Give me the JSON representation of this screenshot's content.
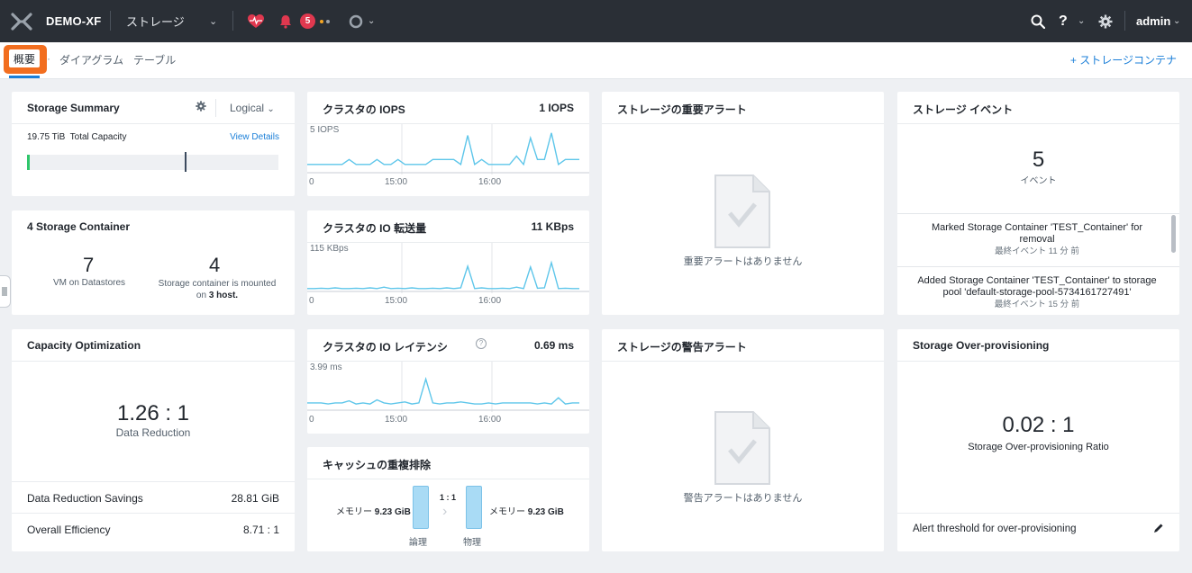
{
  "topbar": {
    "app_title": "DEMO-XF",
    "nav_label": "ストレージ",
    "alert_count": "5",
    "user": "admin",
    "colors": {
      "bg": "#2a2f36",
      "alert": "#e0384f",
      "dot_orange": "#f5a623",
      "dot_gray": "#9aa2ab"
    }
  },
  "subnav": {
    "tabs": [
      {
        "label": "概要",
        "active": true
      },
      {
        "label": "ダイアグラム"
      },
      {
        "label": "テーブル"
      }
    ],
    "separator": "·",
    "add_button": "+ ストレージコンテナ",
    "highlight_color": "#f26e1f"
  },
  "storage_summary": {
    "title": "Storage Summary",
    "mode": "Logical",
    "capacity_value": "19.75 TiB",
    "capacity_label": "Total Capacity",
    "details_link": "View Details",
    "usage_fraction": 0.01
  },
  "storage_container": {
    "title": "4 Storage Container",
    "vm_count": "7",
    "vm_label": "VM on Datastores",
    "container_count": "4",
    "container_label": "Storage container is mounted",
    "host_on": "on",
    "host_count": "3",
    "host_label": "host."
  },
  "capacity_opt": {
    "title": "Capacity Optimization",
    "ratio": "1.26 : 1",
    "ratio_label": "Data Reduction",
    "rows": [
      {
        "label": "Data Reduction Savings",
        "value": "28.81 GiB"
      },
      {
        "label": "Overall Efficiency",
        "value": "8.71 : 1"
      }
    ]
  },
  "iops_chart": {
    "title": "クラスタの IOPS",
    "current": "1 IOPS",
    "max_label": "5 IOPS",
    "ticks": [
      "0",
      "15:00",
      "16:00"
    ],
    "chart_data": {
      "type": "line",
      "y_max": 5,
      "values": [
        1,
        1,
        1,
        1,
        1,
        1,
        1.6,
        1,
        1,
        1,
        1.6,
        1,
        1,
        1.6,
        1,
        1,
        1,
        1,
        1.6,
        1.6,
        1.6,
        1.6,
        1,
        4.5,
        1,
        1.6,
        1,
        1,
        1,
        1,
        2,
        1,
        4.2,
        1.6,
        1.6,
        4.8,
        1,
        1.6,
        1.6,
        1.6
      ]
    }
  },
  "io_chart": {
    "title": "クラスタの IO 転送量",
    "current": "11 KBps",
    "max_label": "115 KBps",
    "ticks": [
      "0",
      "15:00",
      "16:00"
    ],
    "chart_data": {
      "type": "line",
      "y_max": 115,
      "values": [
        8,
        8,
        9,
        8,
        10,
        8,
        8,
        9,
        8,
        10,
        8,
        12,
        8,
        9,
        8,
        10,
        8,
        8,
        9,
        8,
        10,
        8,
        10,
        70,
        8,
        10,
        8,
        8,
        9,
        8,
        12,
        8,
        68,
        9,
        10,
        80,
        8,
        9,
        8,
        8
      ]
    }
  },
  "latency_chart": {
    "title": "クラスタの IO レイテンシ",
    "current": "0.69 ms",
    "max_label": "3.99 ms",
    "ticks": [
      "0",
      "15:00",
      "16:00"
    ],
    "chart_data": {
      "type": "line",
      "y_max": 3.99,
      "values": [
        0.7,
        0.7,
        0.7,
        0.6,
        0.7,
        0.7,
        0.9,
        0.6,
        0.7,
        0.6,
        1.0,
        0.7,
        0.6,
        0.7,
        0.8,
        0.6,
        0.7,
        3.0,
        0.7,
        0.6,
        0.7,
        0.7,
        0.8,
        0.7,
        0.6,
        0.6,
        0.7,
        0.6,
        0.7,
        0.7,
        0.7,
        0.7,
        0.7,
        0.6,
        0.7,
        0.6,
        1.2,
        0.6,
        0.7,
        0.7
      ]
    }
  },
  "dedup": {
    "title": "キャッシュの重複排除",
    "ratio": "1 : 1",
    "left_prefix": "メモリー",
    "left_value": "9.23 GiB",
    "right_prefix": "メモリー",
    "right_value": "9.23 GiB",
    "left_label": "論理",
    "right_label": "物理"
  },
  "critical_alerts": {
    "title": "ストレージの重要アラート",
    "empty_text": "重要アラートはありません"
  },
  "warning_alerts": {
    "title": "ストレージの警告アラート",
    "empty_text": "警告アラートはありません"
  },
  "events": {
    "title": "ストレージ イベント",
    "count": "5",
    "count_label": "イベント",
    "items": [
      {
        "text": "Marked Storage Container 'TEST_Container' for removal",
        "time": "最終イベント 11 分 前"
      },
      {
        "text": "Added Storage Container 'TEST_Container' to storage pool 'default-storage-pool-5734161727491'",
        "time": "最終イベント 15 分 前"
      }
    ]
  },
  "overprov": {
    "title": "Storage Over-provisioning",
    "ratio": "0.02 : 1",
    "ratio_label": "Storage Over-provisioning Ratio",
    "threshold_label": "Alert threshold for over-provisioning"
  }
}
